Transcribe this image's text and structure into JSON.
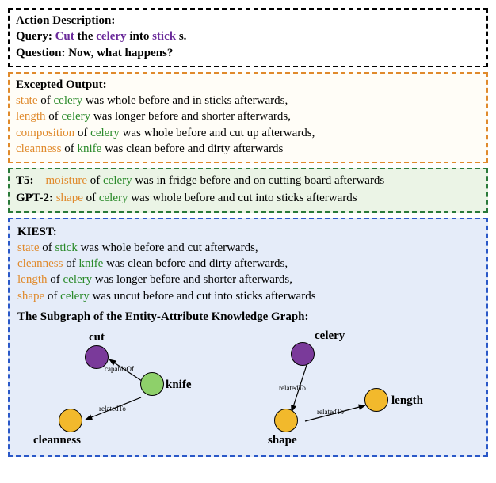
{
  "action": {
    "heading": "Action Description:",
    "query_label": "Query:",
    "query_kw1": "Cut",
    "query_mid1": " the ",
    "query_kw2": "celery",
    "query_mid2": " into ",
    "query_kw3": "stick",
    "query_end": "s.",
    "question_label": "Question:",
    "question_text": " Now, what happens?"
  },
  "expected": {
    "heading": "Excepted Output:",
    "lines": [
      {
        "attr": "state",
        "mid1": " of ",
        "ent": "celery",
        "rest": " was whole before and in sticks afterwards,"
      },
      {
        "attr": "length",
        "mid1": " of ",
        "ent": "celery",
        "rest": " was longer before and shorter afterwards,"
      },
      {
        "attr": "composition",
        "mid1": " of ",
        "ent": "celery",
        "rest": " was whole before and cut up afterwards,"
      },
      {
        "attr": "cleanness",
        "mid1": " of ",
        "ent": "knife",
        "rest": " was clean before and dirty afterwards"
      }
    ]
  },
  "baselines": {
    "t5_label": "T5:",
    "t5_attr": "moisture",
    "t5_mid1": " of ",
    "t5_ent": "celery",
    "t5_rest": " was in fridge before and on cutting board afterwards",
    "gpt_label": "GPT-2:",
    "gpt_attr": "shape",
    "gpt_mid1": " of ",
    "gpt_ent": "celery",
    "gpt_rest": " was whole before and cut into sticks afterwards"
  },
  "kiest": {
    "heading": "KIEST:",
    "lines": [
      {
        "attr": "state",
        "mid1": " of ",
        "ent": "stick",
        "rest": " was whole before and cut afterwards,"
      },
      {
        "attr": "cleanness",
        "mid1": " of ",
        "ent": "knife",
        "rest": " was clean before and dirty afterwards,"
      },
      {
        "attr": "length",
        "mid1": " of ",
        "ent": "celery",
        "rest": " was longer before and shorter afterwards,"
      },
      {
        "attr": "shape",
        "mid1": " of ",
        "ent": "celery",
        "rest": " was uncut before and cut into sticks afterwards"
      }
    ],
    "subgraph_heading": "The Subgraph of the Entity-Attribute Knowledge Graph:",
    "nodes": {
      "cut": "cut",
      "knife": "knife",
      "cleanness": "cleanness",
      "celery": "celery",
      "shape": "shape",
      "length": "length"
    },
    "edges": {
      "capableOf": "capableOf",
      "relatedTo1": "relatedTo",
      "relatedTo2": "relatedTo",
      "relatedTo3": "relatedTo"
    }
  },
  "colors": {
    "purple_node": "#7a3a9a",
    "green_node": "#8ed06a",
    "orange_node": "#f2b92c"
  }
}
